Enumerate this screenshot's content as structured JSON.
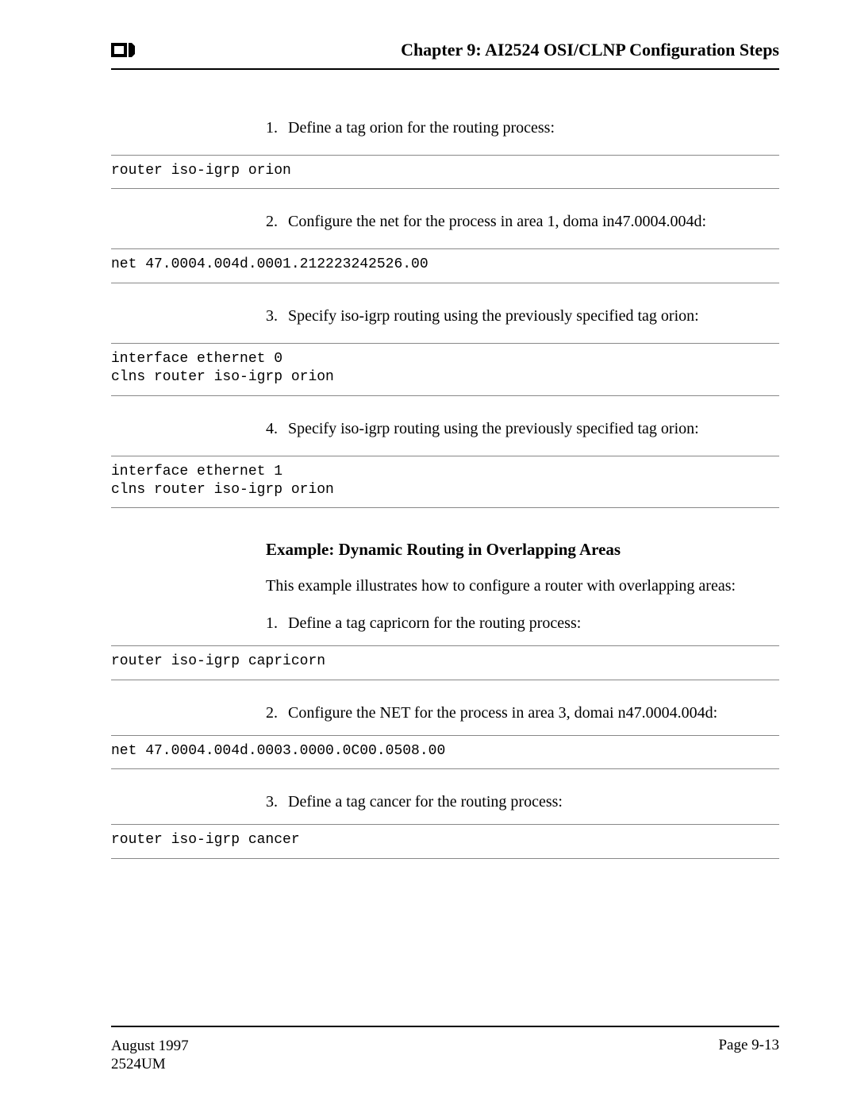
{
  "header": {
    "chapter_title": "Chapter 9: AI2524 OSI/CLNP Configuration Steps"
  },
  "body": {
    "item1_num": "1.",
    "item1_text": "Define a tag orion for the routing process:",
    "code1": "router iso-igrp orion",
    "item2_num": "2.",
    "item2_text": "Configure the net for the process in area 1, doma in47.0004.004d:",
    "code2": "net 47.0004.004d.0001.212223242526.00",
    "item3_num": "3.",
    "item3_text": "Specify iso-igrp routing using the previously specified tag orion:",
    "code3": "interface ethernet 0\nclns router iso-igrp orion",
    "item4_num": "4.",
    "item4_text": "Specify iso-igrp routing using the previously specified tag orion:",
    "code4": "interface ethernet 1\nclns router iso-igrp orion",
    "subheading": "Example: Dynamic Routing in Overlapping Areas",
    "para_intro": "This example illustrates how to configure a router with overlapping areas:",
    "b_item1_num": "1.",
    "b_item1_text": "Define a tag capricorn for the routing process:",
    "b_code1": "router iso-igrp capricorn",
    "b_item2_num": "2.",
    "b_item2_text": "Configure the NET for the process in area 3, domai n47.0004.004d:",
    "b_code2": "net 47.0004.004d.0003.0000.0C00.0508.00",
    "b_item3_num": "3.",
    "b_item3_text": "Define a tag cancer for the routing process:",
    "b_code3": "router iso-igrp cancer"
  },
  "footer": {
    "date": "August 1997",
    "docid": "2524UM",
    "page": "Page 9-13"
  }
}
